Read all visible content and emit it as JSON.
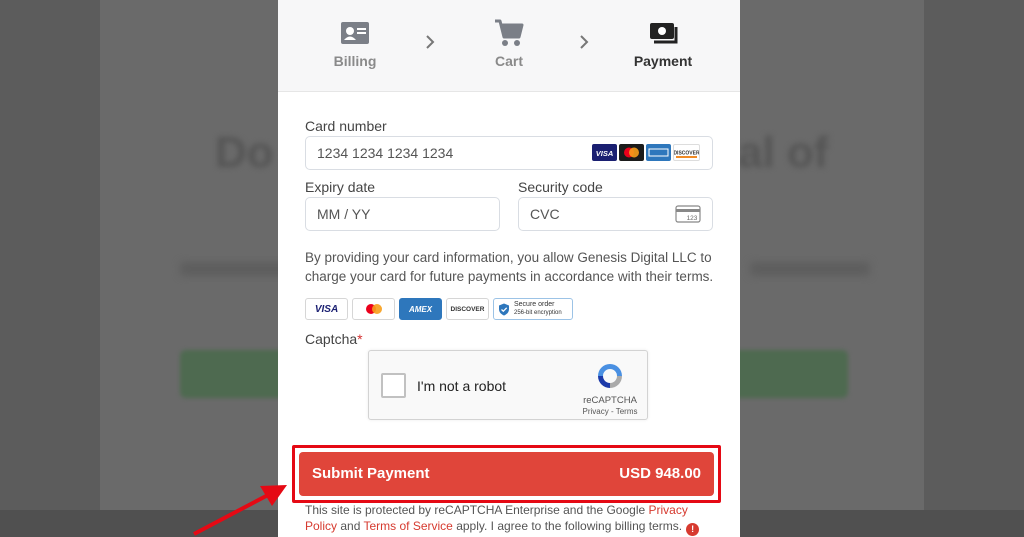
{
  "steps": [
    {
      "label": "Billing",
      "icon": "id-card-icon"
    },
    {
      "label": "Cart",
      "icon": "shopping-cart-icon"
    },
    {
      "label": "Payment",
      "icon": "payment-card-icon"
    }
  ],
  "active_step": "Payment",
  "card_number": {
    "label": "Card number",
    "placeholder": "1234 1234 1234 1234",
    "value": ""
  },
  "card_brands": [
    "VISA",
    "Mastercard",
    "AMEX",
    "DISCOVER"
  ],
  "expiry": {
    "label": "Expiry date",
    "placeholder": "MM / YY",
    "value": ""
  },
  "security": {
    "label": "Security code",
    "placeholder": "CVC",
    "value": "",
    "icon_text": "123"
  },
  "notice": "By providing your card information, you allow Genesis Digital LLC to charge your card for future payments in accordance with their terms.",
  "badges": {
    "visa": "VISA",
    "amex": "AMEX",
    "discover": "DISCOVER",
    "secure_line1": "Secure order",
    "secure_line2": "256-bit encryption"
  },
  "captcha": {
    "label": "Captcha",
    "required_mark": "*",
    "checkbox_text": "I'm not a robot",
    "brand": "reCAPTCHA",
    "links": "Privacy - Terms"
  },
  "submit": {
    "label": "Submit Payment",
    "amount": "USD 948.00"
  },
  "footer": {
    "text_before": "This site is protected by reCAPTCHA Enterprise and the Google ",
    "privacy_link": "Privacy Policy",
    "text_and": " and ",
    "terms_link": "Terms of Service",
    "text_after": " apply. I agree to the following billing terms.",
    "info_glyph": "!"
  },
  "colors": {
    "accent": "#e0453a",
    "highlight_border": "#e50914",
    "link": "#d63a2f",
    "visa_blue": "#1a1f71",
    "amex_blue": "#2e77bc"
  }
}
